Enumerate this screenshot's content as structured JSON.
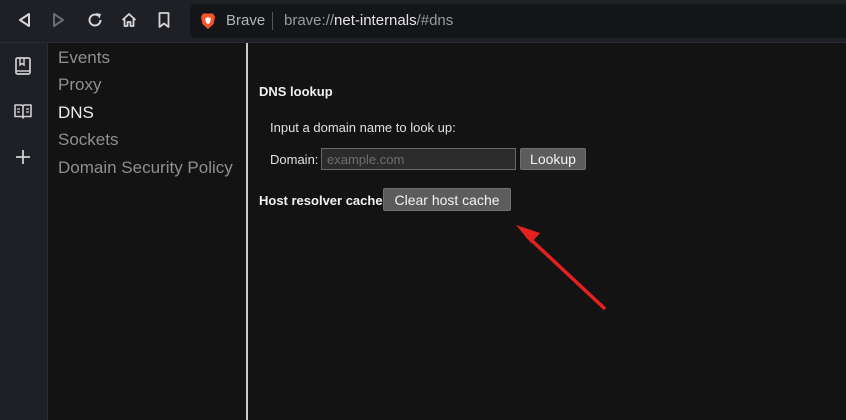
{
  "browser": {
    "brand_label": "Brave",
    "url_scheme": "brave://",
    "url_host": "net-internals",
    "url_path": "/#dns",
    "icons": [
      "back-icon",
      "forward-icon",
      "reload-icon",
      "home-icon",
      "bookmark-icon",
      "brave-lion-icon"
    ]
  },
  "rail": {
    "icons": [
      "bookmarks-panel-icon",
      "reading-list-icon",
      "add-icon"
    ]
  },
  "categories": [
    "Events",
    "Proxy",
    "DNS",
    "Sockets",
    "Domain Security Policy"
  ],
  "active_category": "DNS",
  "dns": {
    "lookup_title": "DNS lookup",
    "prompt": "Input a domain name to look up:",
    "domain_label": "Domain:",
    "domain_placeholder": "example.com",
    "domain_value": "",
    "lookup_button": "Lookup",
    "cache_title": "Host resolver cache",
    "clear_cache_button": "Clear host cache"
  },
  "annotation": {
    "arrow_color": "#e5211f"
  }
}
